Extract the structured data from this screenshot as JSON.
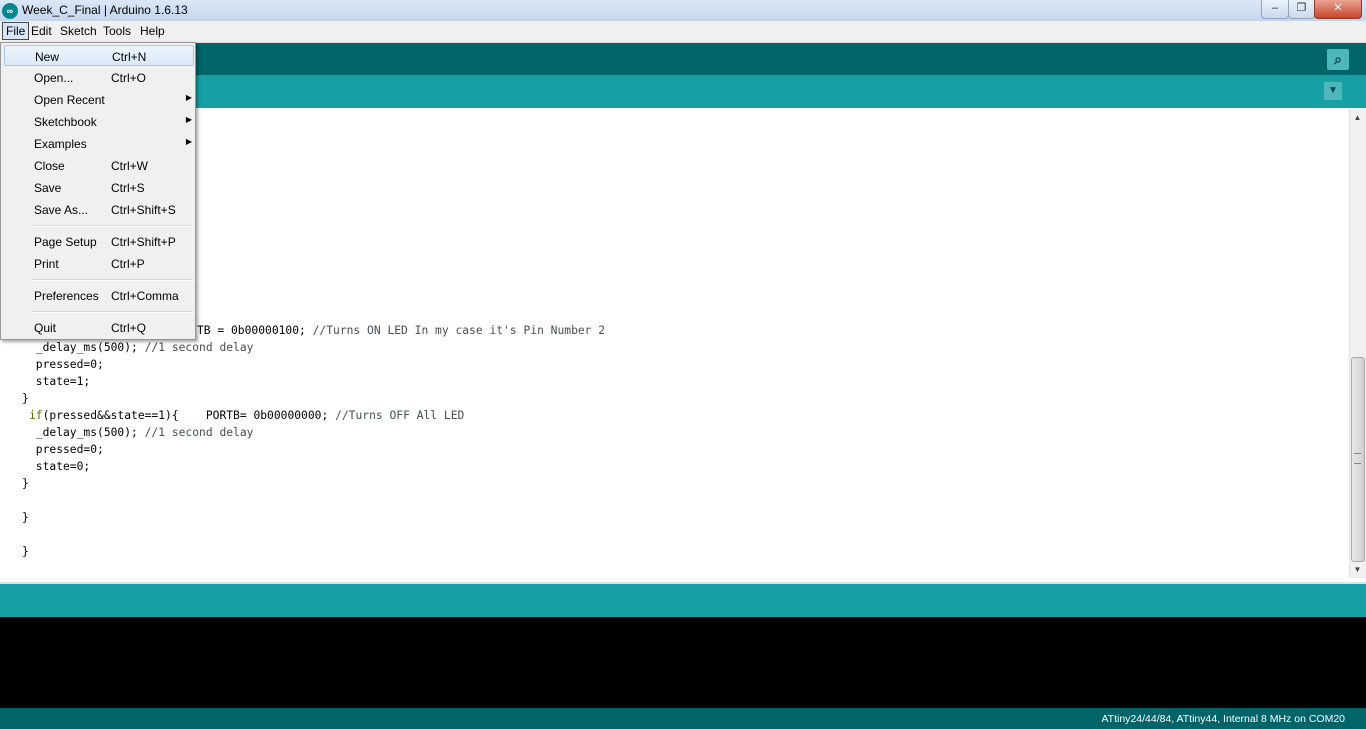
{
  "window": {
    "title": "Week_C_Final | Arduino 1.6.13",
    "icon": "arduino-logo-icon",
    "min_glyph": "–",
    "max_glyph": "❐",
    "close_glyph": "✕"
  },
  "menubar": {
    "items": [
      "File",
      "Edit",
      "Sketch",
      "Tools",
      "Help"
    ]
  },
  "toolbar": {
    "serial_monitor_icon": "serial-monitor-icon",
    "serial_glyph": "⌕",
    "tab_menu_glyph": "▼"
  },
  "file_menu": {
    "items": [
      {
        "label": "New",
        "shortcut": "Ctrl+N"
      },
      {
        "label": "Open...",
        "shortcut": "Ctrl+O"
      },
      {
        "label": "Open Recent",
        "shortcut": "",
        "submenu": "▶"
      },
      {
        "label": "Sketchbook",
        "shortcut": "",
        "submenu": "▶"
      },
      {
        "label": "Examples",
        "shortcut": "",
        "submenu": "▶"
      },
      {
        "label": "Close",
        "shortcut": "Ctrl+W"
      },
      {
        "label": "Save",
        "shortcut": "Ctrl+S"
      },
      {
        "label": "Save As...",
        "shortcut": "Ctrl+Shift+S"
      },
      {
        "label": "Page Setup",
        "shortcut": "Ctrl+Shift+P"
      },
      {
        "label": "Print",
        "shortcut": "Ctrl+P"
      },
      {
        "label": "Preferences",
        "shortcut": "Ctrl+Comma"
      },
      {
        "label": "Quit",
        "shortcut": "Ctrl+Q"
      }
    ]
  },
  "code": {
    "line1_code": "TB = 0b00000100; ",
    "line1_comment": "//Turns ON LED In my case it's Pin Number 2",
    "line2_code": " _delay_ms(500); ",
    "line2_comment": "//1 second delay",
    "line3": " pressed=0;",
    "line4": " state=1;",
    "line5": "}",
    "line6_kw": "if",
    "line6_code": "(pressed&&state==1){    PORTB= 0b00000000; ",
    "line6_comment": "//Turns OFF All LED",
    "line7_code": " _delay_ms(500); ",
    "line7_comment": "//1 second delay",
    "line8": " pressed=0;",
    "line9": " state=0;",
    "line10": "}",
    "line11": "}",
    "line12": "}"
  },
  "scrollbar": {
    "up_glyph": "▲",
    "down_glyph": "▼"
  },
  "footer": {
    "board_info": "ATtiny24/44/84, ATtiny44, Internal 8 MHz on COM20"
  }
}
